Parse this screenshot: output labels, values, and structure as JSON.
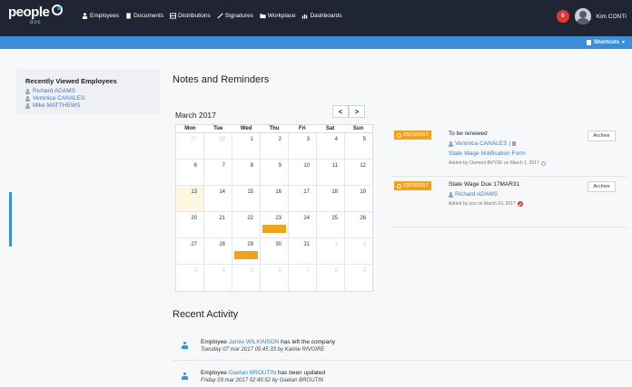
{
  "header": {
    "logo_text": "people",
    "logo_sub": "doc",
    "nav": [
      {
        "label": "Employees",
        "icon": "person-icon"
      },
      {
        "label": "Documents",
        "icon": "document-icon"
      },
      {
        "label": "Distributions",
        "icon": "distribution-icon"
      },
      {
        "label": "Signatures",
        "icon": "pen-icon"
      },
      {
        "label": "Workplace",
        "icon": "folder-icon"
      },
      {
        "label": "Dashboards",
        "icon": "chart-icon"
      }
    ],
    "notification_count": "0",
    "user_name": "Kim CONTI"
  },
  "subbar": {
    "shortcuts_label": "Shortcuts"
  },
  "recent_employees": {
    "title": "Recently Viewed Employees",
    "items": [
      "Richard ADAMS",
      "Veronica CANALES",
      "Mike MATTHEWS"
    ]
  },
  "notes": {
    "title": "Notes and Reminders",
    "calendar": {
      "month": "March 2017",
      "prev_label": "<",
      "next_label": ">",
      "weekdays": [
        "Mon",
        "Tue",
        "Wed",
        "Thu",
        "Fri",
        "Sat",
        "Sun"
      ],
      "weeks": [
        [
          "27",
          "28",
          "1",
          "2",
          "3",
          "4",
          "5"
        ],
        [
          "6",
          "7",
          "8",
          "9",
          "10",
          "11",
          "12"
        ],
        [
          "13",
          "14",
          "15",
          "16",
          "17",
          "18",
          "19"
        ],
        [
          "20",
          "21",
          "22",
          "23",
          "24",
          "25",
          "26"
        ],
        [
          "27",
          "28",
          "29",
          "30",
          "31",
          "1",
          "2"
        ],
        [
          "3",
          "4",
          "5",
          "6",
          "7",
          "8",
          "9"
        ]
      ],
      "event_color": "#f0a21e"
    },
    "reminders": [
      {
        "date": "03/23/2017",
        "title": "To be renewed",
        "employee": "Veronica CANALES",
        "separator": "|",
        "document": "State Wage Notification Form",
        "added": "Added by Clement BUYSE on March 1, 2017",
        "archive_label": "Archive"
      },
      {
        "date": "03/29/2017",
        "title": "State Wage Due 17MAR31",
        "employee": "Richard ADAMS",
        "added": "Added by you on March 10, 2017",
        "archive_label": "Archive"
      }
    ]
  },
  "activity": {
    "title": "Recent Activity",
    "items": [
      {
        "prefix": "Employee",
        "name": "Jamie WILKINSON",
        "action": "has left the company",
        "meta": "Tuesday 07 mar 2017 05:45:33 by Karine RIVOIRE"
      },
      {
        "prefix": "Employee",
        "name": "Gaetan BROUTIN",
        "action": "has been updated",
        "meta": "Friday 03 mar 2017 02:45:52 by Gaetan BROUTIN"
      }
    ]
  }
}
